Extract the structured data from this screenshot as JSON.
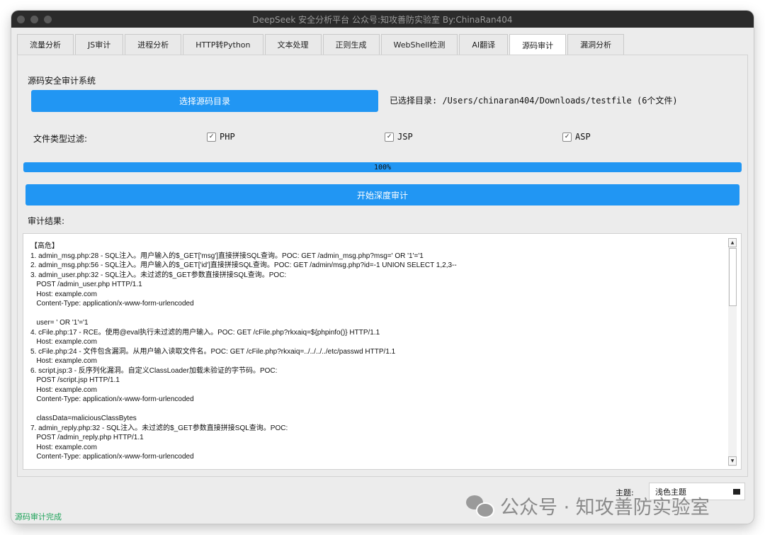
{
  "window": {
    "title": "DeepSeek 安全分析平台 公众号:知攻善防实验室 By:ChinaRan404"
  },
  "tabs": [
    {
      "label": "流量分析",
      "active": false
    },
    {
      "label": "JS审计",
      "active": false
    },
    {
      "label": "进程分析",
      "active": false
    },
    {
      "label": "HTTP转Python",
      "active": false
    },
    {
      "label": "文本处理",
      "active": false
    },
    {
      "label": "正则生成",
      "active": false
    },
    {
      "label": "WebShell检测",
      "active": false
    },
    {
      "label": "AI翻译",
      "active": false
    },
    {
      "label": "源码审计",
      "active": true
    },
    {
      "label": "漏洞分析",
      "active": false
    }
  ],
  "audit": {
    "title": "源码安全审计系统",
    "select_dir_button": "选择源码目录",
    "selected_dir": "已选择目录: /Users/chinaran404/Downloads/testfile (6个文件)",
    "filter_label": "文件类型过滤:",
    "filters": [
      {
        "label": "PHP",
        "checked": true,
        "check_mark": "✓"
      },
      {
        "label": "JSP",
        "checked": true,
        "check_mark": "✓"
      },
      {
        "label": "ASP",
        "checked": true,
        "check_mark": "✓"
      }
    ],
    "progress": {
      "value": 100,
      "text": "100%"
    },
    "start_button": "开始深度审计",
    "result_label": "审计结果:",
    "result_text": "【高危】\n1. admin_msg.php:28 - SQL注入。用户输入的$_GET['msg']直接拼接SQL查询。POC: GET /admin_msg.php?msg=' OR '1'='1\n2. admin_msg.php:56 - SQL注入。用户输入的$_GET['id']直接拼接SQL查询。POC: GET /admin/msg.php?id=-1 UNION SELECT 1,2,3--\n3. admin_user.php:32 - SQL注入。未过滤的$_GET参数直接拼接SQL查询。POC:\n   POST /admin_user.php HTTP/1.1\n   Host: example.com\n   Content-Type: application/x-www-form-urlencoded\n\n   user= ' OR '1'='1\n4. cFile.php:17 - RCE。使用@eval执行未过滤的用户输入。POC: GET /cFile.php?rkxaiq=${phpinfo()} HTTP/1.1\n   Host: example.com\n5. cFile.php:24 - 文件包含漏洞。从用户输入读取文件名。POC: GET /cFile.php?rkxaiq=../../../../etc/passwd HTTP/1.1\n   Host: example.com\n6. script.jsp:3 - 反序列化漏洞。自定义ClassLoader加载未验证的字节码。POC:\n   POST /script.jsp HTTP/1.1\n   Host: example.com\n   Content-Type: application/x-www-form-urlencoded\n\n   classData=maliciousClassBytes\n7. admin_reply.php:32 - SQL注入。未过滤的$_GET参数直接拼接SQL查询。POC:\n   POST /admin_reply.php HTTP/1.1\n   Host: example.com\n   Content-Type: application/x-www-form-urlencoded"
  },
  "scrollbar": {
    "up_arrow": "▲",
    "down_arrow": "▼"
  },
  "theme": {
    "label": "主题:",
    "value": "浅色主题"
  },
  "status": "源码审计完成",
  "watermark": "公众号 · 知攻善防实验室",
  "colors": {
    "accent": "#2196f3",
    "status": "#1fa35a"
  }
}
